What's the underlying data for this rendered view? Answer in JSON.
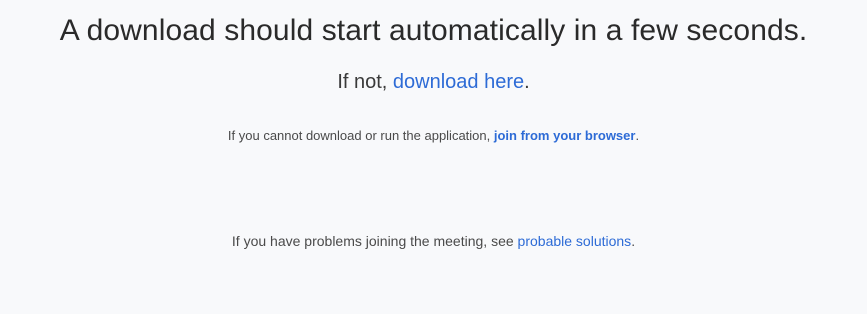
{
  "headline": "A download should start automatically in a few seconds.",
  "fallback": {
    "prefix": "If not, ",
    "link_text": "download here",
    "suffix": "."
  },
  "browser_join": {
    "prefix": "If you cannot download or run the application, ",
    "link_text": "join from your browser",
    "suffix": "."
  },
  "help": {
    "prefix": "If you have problems joining the meeting, see ",
    "link_text": "probable solutions",
    "suffix": "."
  },
  "colors": {
    "link": "#2d6bd6",
    "text": "#2a2a2a",
    "background": "#f8f9fb"
  }
}
